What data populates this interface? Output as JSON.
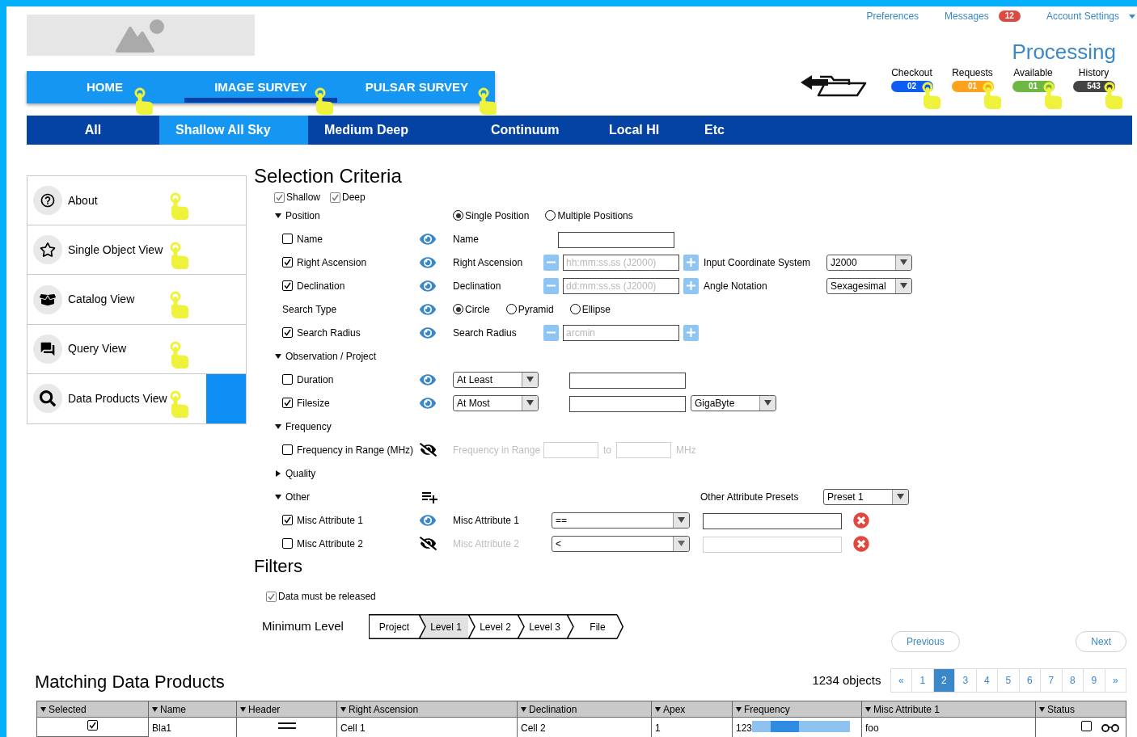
{
  "top_links": [
    {
      "label": "Preferences"
    },
    {
      "label": "Messages",
      "badge": "12"
    },
    {
      "label": "Account Settings",
      "dropdown": true
    }
  ],
  "main_tabs": [
    {
      "label": "HOME",
      "selected": false
    },
    {
      "label": "IMAGE SURVEY",
      "selected": true
    },
    {
      "label": "PULSAR SURVEY",
      "selected": false
    }
  ],
  "processing": {
    "title": "Processing",
    "queues": [
      {
        "label": "Checkout",
        "count": "02",
        "color": "#0f5cf5"
      },
      {
        "label": "Requests",
        "count": "01",
        "color": "#fca21c"
      },
      {
        "label": "Available",
        "count": "01",
        "color": "#6cb843"
      },
      {
        "label": "History",
        "count": "543",
        "color": "#444444"
      }
    ]
  },
  "sub_tabs": [
    {
      "label": "All",
      "selected": false
    },
    {
      "label": "Shallow All Sky",
      "selected": true
    },
    {
      "label": "Medium Deep",
      "selected": false
    },
    {
      "label": "Continuum",
      "selected": false
    },
    {
      "label": "Local HI",
      "selected": false
    },
    {
      "label": "Etc",
      "selected": false
    }
  ],
  "sidebar": {
    "items": [
      {
        "label": "About",
        "selected": false
      },
      {
        "label": "Single Object View",
        "selected": false
      },
      {
        "label": "Catalog View",
        "selected": false
      },
      {
        "label": "Query View",
        "selected": false
      },
      {
        "label": "Data Products View",
        "selected": true
      }
    ]
  },
  "selection_criteria": {
    "title": "Selection Criteria",
    "surveys": [
      {
        "label": "Shallow",
        "checked": true
      },
      {
        "label": "Deep",
        "checked": true
      }
    ],
    "rows": [
      {
        "kind": "group",
        "label": "Position",
        "expanded": true,
        "controls": [
          {
            "kind": "radio",
            "label": "Single Position",
            "selected": true
          },
          {
            "kind": "radio",
            "label": "Multiple Positions",
            "selected": false
          }
        ]
      },
      {
        "kind": "item",
        "label": "Name",
        "checked": false,
        "visible": true,
        "disabled": false,
        "controls": [
          {
            "kind": "label",
            "text": "Name"
          },
          {
            "kind": "input"
          }
        ]
      },
      {
        "kind": "item",
        "label": "Right Ascension",
        "checked": true,
        "visible": true,
        "disabled": false,
        "controls": [
          {
            "kind": "label",
            "text": "Right Ascension"
          },
          {
            "kind": "stepper",
            "placeholder": "hh:mm:ss.ss (J2000)"
          },
          {
            "kind": "caption",
            "text": "Input Coordinate System"
          },
          {
            "kind": "select",
            "value": "J2000"
          }
        ]
      },
      {
        "kind": "item",
        "label": "Declination",
        "checked": true,
        "visible": true,
        "disabled": false,
        "controls": [
          {
            "kind": "label",
            "text": "Declination"
          },
          {
            "kind": "stepper",
            "placeholder": "dd:mm:ss.ss (J2000)"
          },
          {
            "kind": "caption",
            "text": "Angle Notation"
          },
          {
            "kind": "select",
            "value": "Sexagesimal"
          }
        ]
      },
      {
        "kind": "item",
        "label": "Search Type",
        "visible": true,
        "disabled": false,
        "controls": [
          {
            "kind": "radio",
            "label": "Circle",
            "selected": true
          },
          {
            "kind": "radio",
            "label": "Pyramid",
            "selected": false
          },
          {
            "kind": "radio",
            "label": "Ellipse",
            "selected": false
          }
        ]
      },
      {
        "kind": "item",
        "label": "Search Radius",
        "checked": true,
        "visible": true,
        "disabled": false,
        "controls": [
          {
            "kind": "label",
            "text": "Search Radius"
          },
          {
            "kind": "stepper",
            "placeholder": "arcmin"
          }
        ]
      },
      {
        "kind": "group",
        "label": "Observation / Project",
        "expanded": true,
        "controls": []
      },
      {
        "kind": "item",
        "label": "Duration",
        "checked": false,
        "visible": true,
        "disabled": false,
        "controls": [
          {
            "kind": "select",
            "value": "At Least"
          },
          {
            "kind": "input"
          }
        ]
      },
      {
        "kind": "item",
        "label": "Filesize",
        "checked": true,
        "visible": true,
        "disabled": false,
        "controls": [
          {
            "kind": "select",
            "value": "At Most"
          },
          {
            "kind": "input"
          },
          {
            "kind": "select",
            "value": "GigaByte"
          }
        ]
      },
      {
        "kind": "group",
        "label": "Frequency",
        "expanded": true,
        "controls": []
      },
      {
        "kind": "item",
        "label": "Frequency in Range (MHz)",
        "checked": false,
        "visible": false,
        "disabled": true,
        "controls": [
          {
            "kind": "label",
            "text": "Frequency in Range"
          },
          {
            "kind": "short_input"
          },
          {
            "kind": "text",
            "text": "to"
          },
          {
            "kind": "short_input"
          },
          {
            "kind": "text",
            "text": "MHz"
          }
        ]
      },
      {
        "kind": "group",
        "label": "Quality",
        "expanded": false,
        "controls": []
      },
      {
        "kind": "group",
        "label": "Other",
        "expanded": true,
        "can_add": true,
        "controls": [
          {
            "kind": "caption",
            "text": "Other Attribute Presets"
          },
          {
            "kind": "select",
            "value": "Preset 1"
          }
        ]
      },
      {
        "kind": "item",
        "label": "Misc Attribute 1",
        "checked": true,
        "visible": true,
        "disabled": false,
        "controls": [
          {
            "kind": "label",
            "text": "Misc Attribute 1"
          },
          {
            "kind": "wide_select",
            "value": "=="
          },
          {
            "kind": "wide_input"
          },
          {
            "kind": "remove"
          }
        ]
      },
      {
        "kind": "item",
        "label": "Misc Attribute 2",
        "checked": false,
        "visible": false,
        "disabled": true,
        "controls": [
          {
            "kind": "label",
            "text": "Misc Attribute 2"
          },
          {
            "kind": "wide_select",
            "value": "<"
          },
          {
            "kind": "wide_input"
          },
          {
            "kind": "remove"
          }
        ]
      }
    ]
  },
  "filters": {
    "title": "Filters",
    "release": {
      "label": "Data must be released",
      "checked": true
    },
    "min_level": {
      "label": "Minimum Level",
      "steps": [
        {
          "label": "Project",
          "selected": false
        },
        {
          "label": "Level 1",
          "selected": true
        },
        {
          "label": "Level 2",
          "selected": false
        },
        {
          "label": "Level 3",
          "selected": false
        },
        {
          "label": "File",
          "selected": false
        }
      ]
    }
  },
  "pager_buttons": [
    "Previous",
    "Next"
  ],
  "results": {
    "title": "Matching Data Products",
    "count": "1234 objects",
    "pages": [
      {
        "label": "«",
        "selected": false
      },
      {
        "label": "1",
        "selected": false
      },
      {
        "label": "2",
        "selected": true
      },
      {
        "label": "3",
        "selected": false
      },
      {
        "label": "4",
        "selected": false
      },
      {
        "label": "5",
        "selected": false
      },
      {
        "label": "6",
        "selected": false
      },
      {
        "label": "7",
        "selected": false
      },
      {
        "label": "8",
        "selected": false
      },
      {
        "label": "9",
        "selected": false
      },
      {
        "label": "»",
        "selected": false
      }
    ],
    "table": {
      "columns": [
        "Selected",
        "Name",
        "Header",
        "Right Ascension",
        "Declination",
        "Apex",
        "Frequency",
        "Misc Attribute 1",
        "Status"
      ],
      "rows": [
        {
          "selected": true,
          "name": "Bla1",
          "right_ascension": "Cell 1",
          "declination": "Cell 2",
          "apex": "1",
          "frequency": "123",
          "misc_attribute_1": "foo",
          "status_checked": false
        }
      ]
    }
  }
}
